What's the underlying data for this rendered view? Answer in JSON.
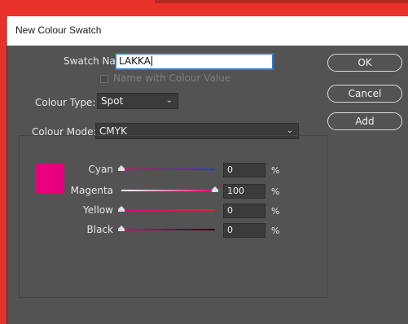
{
  "window": {
    "title": "New Colour Swatch"
  },
  "colors": {
    "frame": "#e8312a",
    "dialog_bg": "#535353",
    "swatch": "#e8007f",
    "focus": "#2f7ad8"
  },
  "form": {
    "swatch_name_label": "Swatch Name:",
    "swatch_name_value": "LAKKA",
    "name_with_value_label": "Name with Colour Value",
    "name_with_value_checked": false,
    "colour_type_label": "Colour Type:",
    "colour_type_value": "Spot",
    "colour_mode_label": "Colour Mode:",
    "colour_mode_value": "CMYK"
  },
  "buttons": {
    "ok": "OK",
    "cancel": "Cancel",
    "add": "Add"
  },
  "channels": [
    {
      "name": "Cyan",
      "value": "0",
      "unit": "%",
      "level": 0,
      "track": "linear-gradient(90deg,#e8007f,#2a3ad8)"
    },
    {
      "name": "Magenta",
      "value": "100",
      "unit": "%",
      "level": 1,
      "track": "linear-gradient(90deg,#ffffff,#e8007f)"
    },
    {
      "name": "Yellow",
      "value": "0",
      "unit": "%",
      "level": 0,
      "track": "linear-gradient(90deg,#e8007f,#e8203a)"
    },
    {
      "name": "Black",
      "value": "0",
      "unit": "%",
      "level": 0,
      "track": "linear-gradient(90deg,#e8007f,#2a0012)"
    }
  ]
}
